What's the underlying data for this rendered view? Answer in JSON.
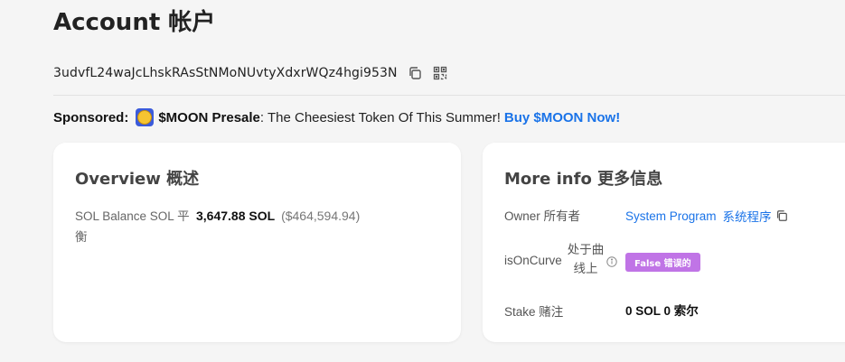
{
  "page": {
    "title": "Account 帐户"
  },
  "account": {
    "address": "3udvfL24waJcLhskRAsStNMoNUvtyXdxrWQz4hgi953N"
  },
  "sponsored": {
    "label": "Sponsored:",
    "name": "$MOON Presale",
    "text": ": The Cheesiest Token Of This Summer!",
    "cta": "Buy $MOON Now!",
    "icon": "moon-coin-icon"
  },
  "overview": {
    "title": "Overview 概述",
    "balance_label": "SOL Balance SOL 平衡",
    "balance_sol": "3,647.88 SOL",
    "balance_usd": "($464,594.94)"
  },
  "more_info": {
    "title": "More info 更多信息",
    "owner_label": "Owner 所有者",
    "owner_value": "System Program",
    "owner_value_cn": "系统程序",
    "curve_label": "isOnCurve",
    "curve_label_cn": "处于曲线上",
    "curve_value": "False 错误的",
    "stake_label": "Stake 赌注",
    "stake_value": "0 SOL 0 索尔"
  },
  "colors": {
    "link": "#1a73e8",
    "badge": "#c074e6",
    "background": "#f5f5f5",
    "card": "#ffffff"
  }
}
